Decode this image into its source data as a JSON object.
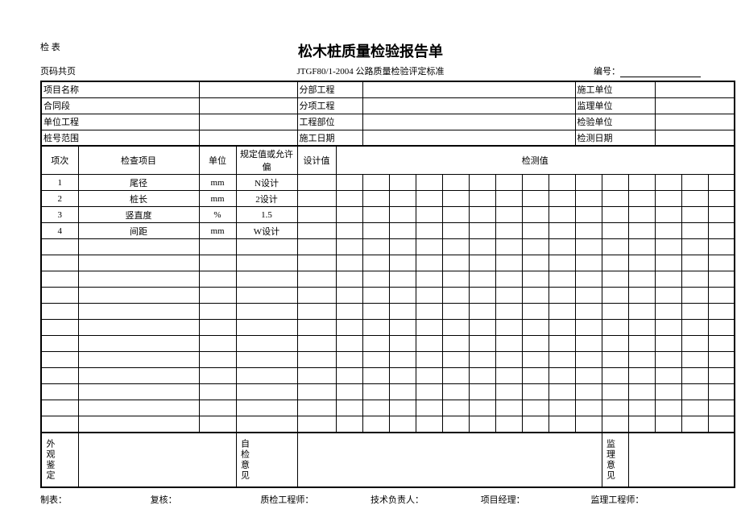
{
  "header": {
    "check_table": "检 表",
    "page_label": "页码共页",
    "title": "松木桩质量检验报告单",
    "standard": "JTGF80/1-2004 公路质量检验评定标准",
    "number_label": "编号："
  },
  "info_labels": {
    "project_name": "项目名称",
    "section_project": "分部工程",
    "construction_unit": "施工单位",
    "contract_section": "合同段",
    "sub_project": "分项工程",
    "supervision_unit": "监理单位",
    "unit_project": "单位工程",
    "project_part": "工程部位",
    "inspection_unit": "检验单位",
    "pile_range": "桩号范围",
    "construction_date": "施工日期",
    "inspection_date": "检测日期"
  },
  "columns": {
    "seq": "项次",
    "check_item": "检查项目",
    "unit": "单位",
    "spec_dev": "规定值或允许偏",
    "design_val": "设计值",
    "measured_val": "检测值"
  },
  "rows": [
    {
      "seq": "1",
      "item": "尾径",
      "unit": "mm",
      "spec": "N设计"
    },
    {
      "seq": "2",
      "item": "桩长",
      "unit": "mm",
      "spec": "2设计"
    },
    {
      "seq": "3",
      "item": "竖直度",
      "unit": "%",
      "spec": "1.5"
    },
    {
      "seq": "4",
      "item": "间距",
      "unit": "mm",
      "spec": "W设计"
    }
  ],
  "bottom": {
    "appearance": "外观鉴定",
    "self_check": "自检意见",
    "supervision_opinion": "监理意见"
  },
  "footer": {
    "maker": "制表：",
    "reviewer": "复核：",
    "qc_engineer": "质检工程师：",
    "tech_leader": "技术负责人：",
    "project_manager": "项目经理：",
    "supervision_engineer": "监理工程师："
  }
}
